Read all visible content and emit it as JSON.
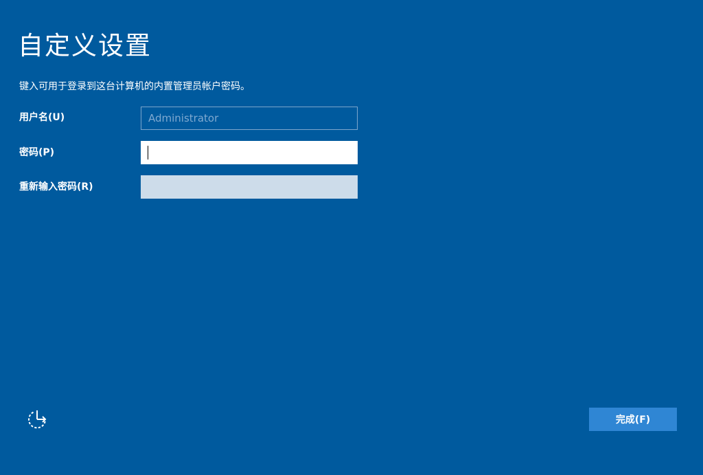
{
  "page": {
    "title": "自定义设置",
    "description": "键入可用于登录到这台计算机的内置管理员帐户密码。"
  },
  "form": {
    "username": {
      "label": "用户名(U)",
      "value": "",
      "placeholder": "Administrator"
    },
    "password": {
      "label": "密码(P)",
      "value": "",
      "placeholder": ""
    },
    "confirm_password": {
      "label": "重新输入密码(R)",
      "value": "",
      "placeholder": ""
    }
  },
  "footer": {
    "accessibility_icon": "ease-of-access-icon",
    "finish_label": "完成(F)"
  },
  "colors": {
    "background": "#005a9e",
    "button": "#2f86d4",
    "disabled_field": "#cddcea"
  }
}
